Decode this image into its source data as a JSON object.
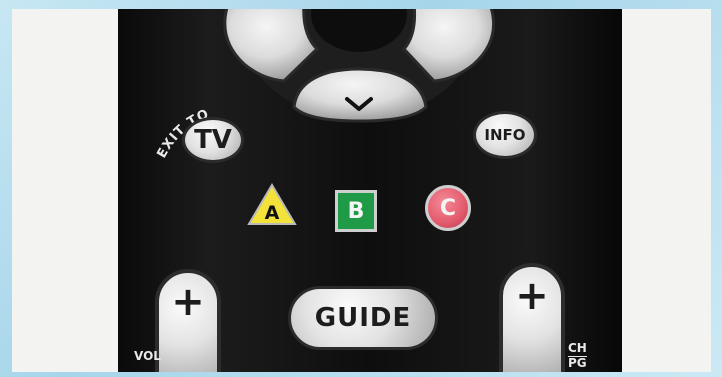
{
  "remote": {
    "exit_to_label": "EXIT TO",
    "tv_label": "TV",
    "info_label": "INFO",
    "button_a": "A",
    "button_b": "B",
    "button_c": "C",
    "guide_label": "GUIDE",
    "vol_label": "VOL",
    "vol_plus": "+",
    "ch_label": "CH",
    "pg_label": "PG",
    "ch_plus": "+"
  },
  "colors": {
    "background": "#a6d5ea",
    "remote_body": "#111111",
    "button_light": "#e3e3e3",
    "a_yellow": "#f2e23a",
    "b_green": "#1f9a46",
    "c_red": "#e25a6c"
  },
  "icons": {
    "down_arrow": "chevron-down-icon"
  }
}
